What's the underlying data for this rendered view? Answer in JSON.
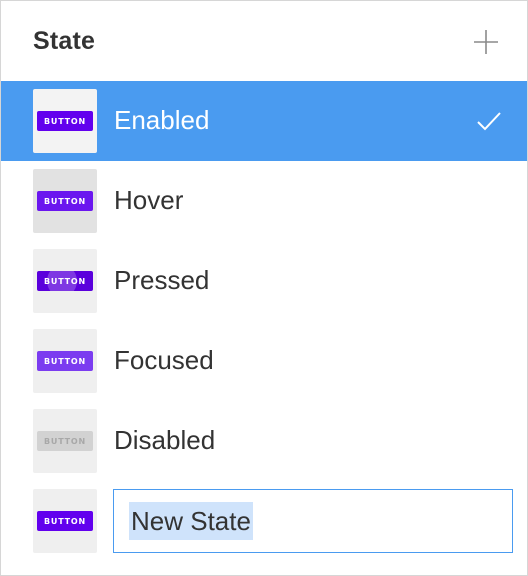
{
  "panel": {
    "title": "State",
    "add_icon": "plus-icon"
  },
  "states": [
    {
      "name": "Enabled",
      "preview_label": "BUTTON",
      "selected": true
    },
    {
      "name": "Hover",
      "preview_label": "BUTTON"
    },
    {
      "name": "Pressed",
      "preview_label": "BUTTON"
    },
    {
      "name": "Focused",
      "preview_label": "BUTTON"
    },
    {
      "name": "Disabled",
      "preview_label": "BUTTON"
    }
  ],
  "new_state": {
    "preview_label": "BUTTON",
    "value": "New State"
  },
  "colors": {
    "selection": "#4a9bf0",
    "button_primary": "#6200ee",
    "button_disabled": "#d2d2d2"
  },
  "icons": {
    "selected": "checkmark-icon"
  }
}
